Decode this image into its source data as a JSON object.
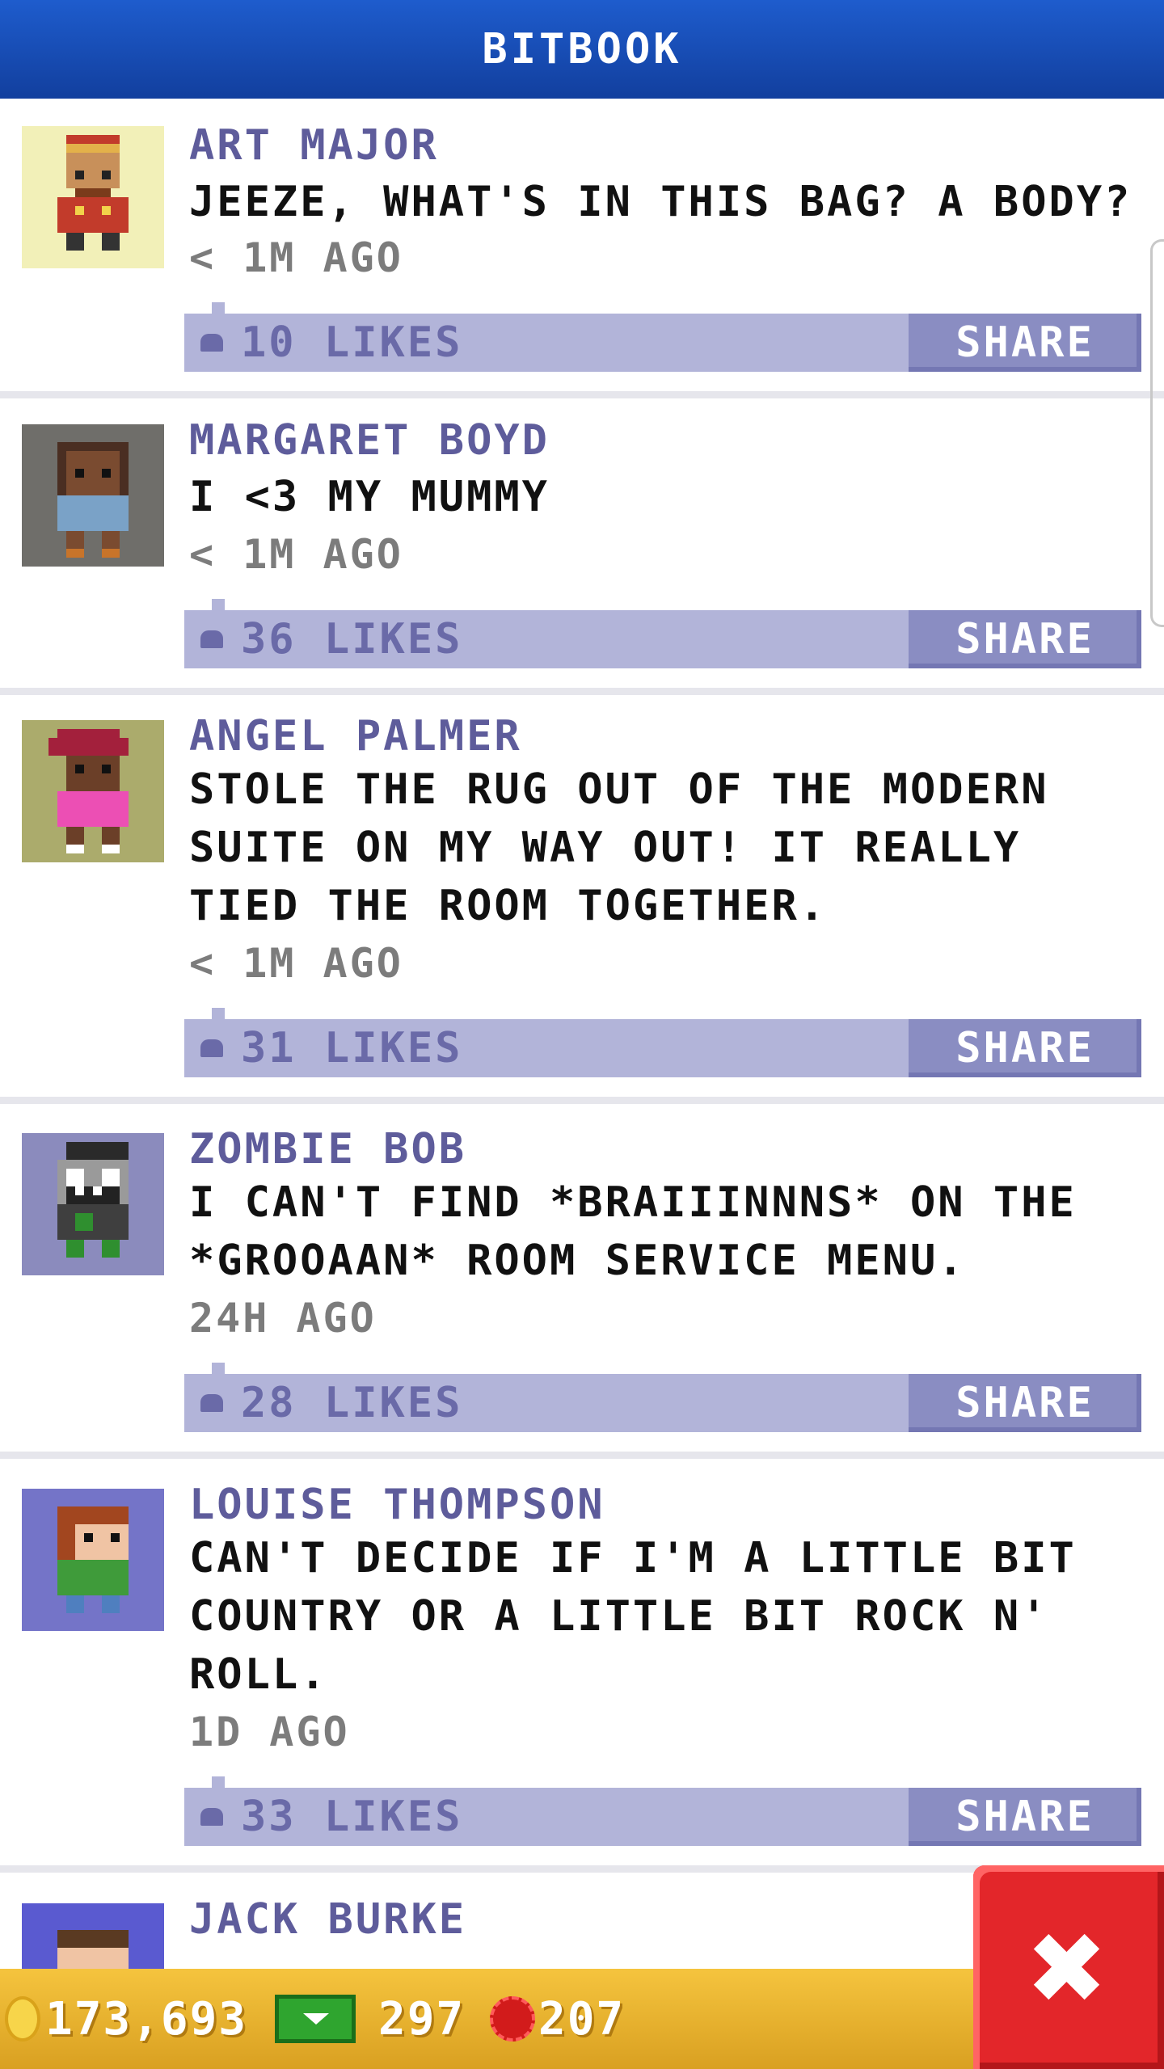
{
  "header": {
    "title": "BITBOOK"
  },
  "posts": [
    {
      "author": "ART MAJOR",
      "message": "JEEZE, WHAT'S IN THIS BAG? A BODY?",
      "time": "< 1M AGO",
      "likes": "10 LIKES",
      "share": "SHARE",
      "avatar_bg": "#f2f0b8"
    },
    {
      "author": "MARGARET BOYD",
      "message": "I <3 MY MUMMY",
      "time": "< 1M AGO",
      "likes": "36 LIKES",
      "share": "SHARE",
      "avatar_bg": "#6f6e6a"
    },
    {
      "author": "ANGEL PALMER",
      "message": "STOLE THE RUG OUT OF THE MODERN SUITE ON MY WAY OUT! IT REALLY TIED THE ROOM TOGETHER.",
      "time": "< 1M AGO",
      "likes": "31 LIKES",
      "share": "SHARE",
      "avatar_bg": "#abab6c"
    },
    {
      "author": "ZOMBIE BOB",
      "message": "I CAN'T FIND *BRAIIINNNS* ON THE *GROOAAN* ROOM SERVICE MENU.",
      "time": "24H AGO",
      "likes": "28 LIKES",
      "share": "SHARE",
      "avatar_bg": "#8b8bbd"
    },
    {
      "author": "LOUISE THOMPSON",
      "message": "CAN'T DECIDE IF I'M A LITTLE BIT COUNTRY OR A LITTLE BIT ROCK N' ROLL.",
      "time": "1D AGO",
      "likes": "33 LIKES",
      "share": "SHARE",
      "avatar_bg": "#7474c8"
    },
    {
      "author": "JACK BURKE",
      "message": "",
      "time": "",
      "likes": "",
      "share": "",
      "avatar_bg": "#5a5ad0"
    }
  ],
  "bottom_bar": {
    "coins": "173,693",
    "bux": "297",
    "gems": "207"
  },
  "close_button": {
    "icon": "close-icon"
  }
}
